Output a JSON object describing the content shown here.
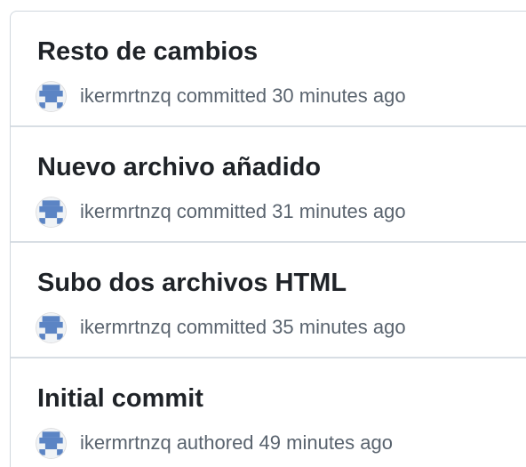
{
  "commits": [
    {
      "title": "Resto de cambios",
      "author": "ikermrtnzq",
      "action": "committed",
      "time": "30 minutes ago"
    },
    {
      "title": "Nuevo archivo añadido",
      "author": "ikermrtnzq",
      "action": "committed",
      "time": "31 minutes ago"
    },
    {
      "title": "Subo dos archivos HTML",
      "author": "ikermrtnzq",
      "action": "committed",
      "time": "35 minutes ago"
    },
    {
      "title": "Initial commit",
      "author": "ikermrtnzq",
      "action": "authored",
      "time": "49 minutes ago"
    }
  ],
  "avatar": {
    "icon": "identicon-avatar-icon",
    "background": "#f0f3f6",
    "pattern": "#5b84c4"
  },
  "colors": {
    "title": "#1f2328",
    "muted": "#59636e",
    "divider": "#d8dee4"
  }
}
